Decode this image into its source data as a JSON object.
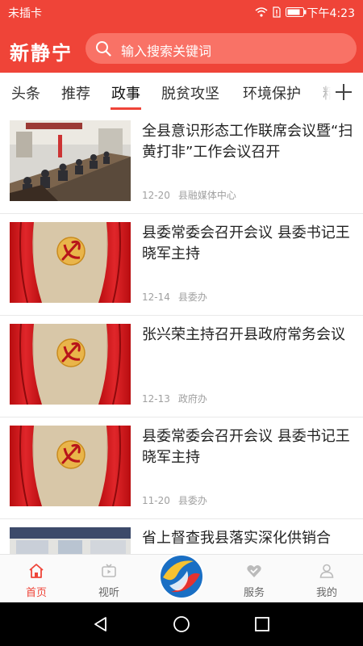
{
  "status_bar": {
    "carrier": "未插卡",
    "time": "下午4:23"
  },
  "header": {
    "logo": "新静宁",
    "search_placeholder": "输入搜索关键词"
  },
  "tabs": [
    "头条",
    "推荐",
    "政事",
    "脱贫攻坚",
    "环境保护",
    "精"
  ],
  "active_tab": "政事",
  "news": [
    {
      "title": "全县意识形态工作联席会议暨“扫黄打非”工作会议召开",
      "date": "12-20",
      "source": "县融媒体中心",
      "image": "meeting-photo"
    },
    {
      "title": "县委常委会召开会议 县委书记王晓军主持",
      "date": "12-14",
      "source": "县委办",
      "image": "party-emblem"
    },
    {
      "title": "张兴荣主持召开县政府常务会议",
      "date": "12-13",
      "source": "政府办",
      "image": "party-emblem"
    },
    {
      "title": "县委常委会召开会议 县委书记王晓军主持",
      "date": "11-20",
      "source": "县委办",
      "image": "party-emblem"
    },
    {
      "title": "省上督查我县落实深化供销合",
      "date": "",
      "source": "",
      "image": "meeting-photo"
    }
  ],
  "bottom_nav": [
    {
      "label": "首页",
      "icon": "home-icon"
    },
    {
      "label": "视听",
      "icon": "tv-icon"
    },
    {
      "label": "",
      "icon": "app-logo-icon"
    },
    {
      "label": "服务",
      "icon": "heart-icon"
    },
    {
      "label": "我的",
      "icon": "user-icon"
    }
  ],
  "colors": {
    "primary": "#ef4438",
    "search_bg": "#f97266"
  }
}
